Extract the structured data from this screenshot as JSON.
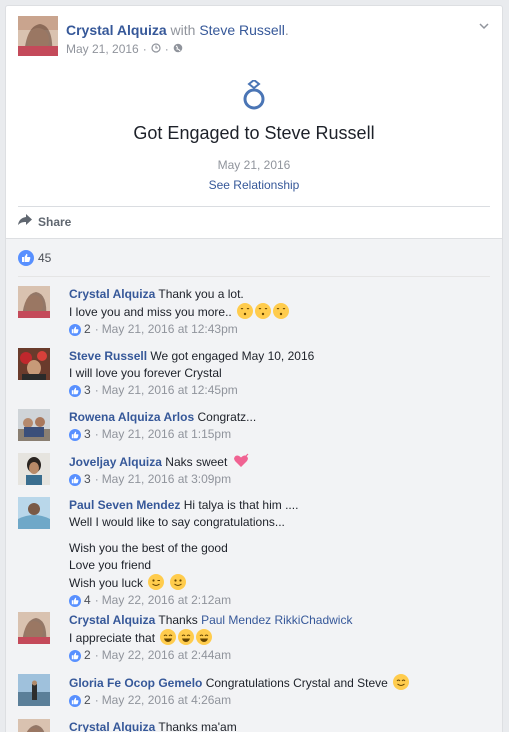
{
  "post": {
    "author": "Crystal Alquiza",
    "with_text": "with",
    "tagged": "Steve Russell",
    "period": ".",
    "date": "May 21, 2016",
    "separator": "·"
  },
  "life_event": {
    "title": "Got Engaged to Steve Russell",
    "date": "May 21, 2016",
    "link": "See Relationship"
  },
  "actions": {
    "share_label": "Share"
  },
  "reactions": {
    "count": "45"
  },
  "comments": [
    {
      "name": "Crystal Alquiza",
      "lines": [
        "Thank you a lot.",
        "I love you and miss you more.."
      ],
      "likes": "2",
      "time": "May 21, 2016 at 12:43pm"
    },
    {
      "name": "Steve Russell",
      "lines": [
        "We got engaged May 10, 2016",
        "I will love you forever Crystal"
      ],
      "likes": "3",
      "time": "May 21, 2016 at 12:45pm"
    },
    {
      "name": "Rowena Alquiza Arlos",
      "lines": [
        "Congratz..."
      ],
      "likes": "3",
      "time": "May 21, 2016 at 1:15pm"
    },
    {
      "name": "Joveljay Alquiza",
      "lines": [
        "Naks sweet"
      ],
      "likes": "3",
      "time": "May 21, 2016 at 3:09pm"
    },
    {
      "name": "Paul Seven Mendez",
      "lines": [
        "Hi talya is that him ....",
        "Well I would like to say congratulations...",
        "",
        "Wish you the best of the good",
        "Love you friend",
        "Wish you luck"
      ],
      "likes": "4",
      "time": "May 22, 2016 at 2:12am"
    },
    {
      "name": "Crystal Alquiza",
      "lines": [
        "Thanks",
        "I appreciate that"
      ],
      "mentions": "Paul Mendez RikkiChadwick",
      "likes": "2",
      "time": "May 22, 2016 at 2:44am"
    },
    {
      "name": "Gloria Fe Ocop Gemelo",
      "lines": [
        "Congratulations Crystal and Steve"
      ],
      "likes": "2",
      "time": "May 22, 2016 at 4:26am"
    },
    {
      "name": "Crystal Alquiza",
      "lines": [
        "Thanks ma'am"
      ],
      "likes": "",
      "time": ""
    }
  ],
  "colors": {
    "link": "#365899",
    "muted": "#90949c",
    "like_blue": "#5890ff",
    "bg": "#e9ebee",
    "comment_bg": "#f2f3f5"
  },
  "icons": [
    "globe-icon",
    "clock-icon",
    "chevron-down-icon",
    "ring-icon",
    "share-arrow-icon",
    "like-thumb-icon",
    "kissing-emoji",
    "heart-emoji",
    "wink-emoji",
    "smile-emoji",
    "grin-emoji"
  ]
}
